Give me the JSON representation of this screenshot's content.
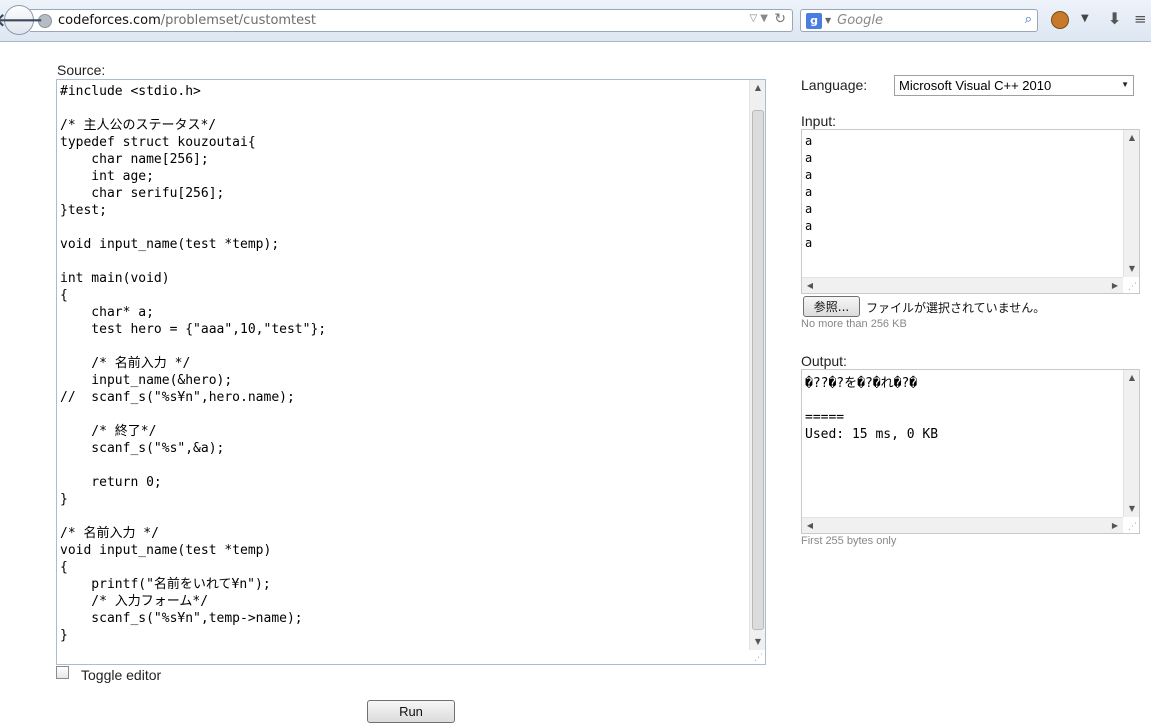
{
  "browser": {
    "url_host": "codeforces.com",
    "url_path": "/problemset/customtest",
    "search_placeholder": "Google",
    "search_engine_glyph": "g"
  },
  "source": {
    "label": "Source:",
    "code": "#include <stdio.h>\n\n/* 主人公のステータス*/\ntypedef struct kouzoutai{\n    char name[256];\n    int age;\n    char serifu[256];\n}test;\n\nvoid input_name(test *temp);\n\nint main(void)\n{\n    char* a;\n    test hero = {\"aaa\",10,\"test\"};\n\n    /* 名前入力 */\n    input_name(&hero);\n//  scanf_s(\"%s¥n\",hero.name);\n\n    /* 終了*/\n    scanf_s(\"%s\",&a);\n\n    return 0;\n}\n\n/* 名前入力 */\nvoid input_name(test *temp)\n{\n    printf(\"名前をいれて¥n\");\n    /* 入力フォーム*/\n    scanf_s(\"%s¥n\",temp->name);\n}",
    "toggle_label": "Toggle editor",
    "run_label": "Run"
  },
  "language": {
    "label": "Language:",
    "selected": "Microsoft Visual C++ 2010"
  },
  "input": {
    "label": "Input:",
    "text": "a\na\na\na\na\na\na",
    "browse_label": "参照...",
    "file_status": "ファイルが選択されていません。",
    "limit_note": "No more than 256 KB"
  },
  "output": {
    "label": "Output:",
    "text": "�??�?を�?�れ�?�\n\n=====\nUsed: 15 ms, 0 KB",
    "limit_note": "First 255 bytes only"
  }
}
